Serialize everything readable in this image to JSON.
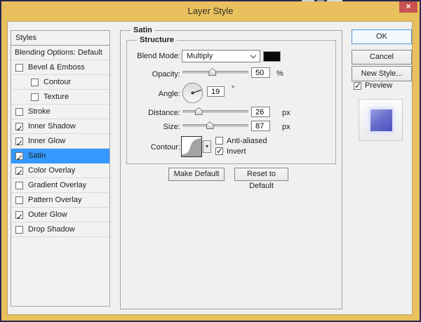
{
  "window": {
    "title": "Layer Style",
    "close_glyph": "×"
  },
  "sidebar": {
    "header": "Styles",
    "items": [
      {
        "label": "Blending Options: Default",
        "checkbox": false,
        "checked": false,
        "indent": false,
        "selected": false
      },
      {
        "label": "Bevel & Emboss",
        "checkbox": true,
        "checked": false,
        "indent": false,
        "selected": false
      },
      {
        "label": "Contour",
        "checkbox": true,
        "checked": false,
        "indent": true,
        "selected": false
      },
      {
        "label": "Texture",
        "checkbox": true,
        "checked": false,
        "indent": true,
        "selected": false
      },
      {
        "label": "Stroke",
        "checkbox": true,
        "checked": false,
        "indent": false,
        "selected": false
      },
      {
        "label": "Inner Shadow",
        "checkbox": true,
        "checked": true,
        "indent": false,
        "selected": false
      },
      {
        "label": "Inner Glow",
        "checkbox": true,
        "checked": true,
        "indent": false,
        "selected": false
      },
      {
        "label": "Satin",
        "checkbox": true,
        "checked": true,
        "indent": false,
        "selected": true
      },
      {
        "label": "Color Overlay",
        "checkbox": true,
        "checked": true,
        "indent": false,
        "selected": false
      },
      {
        "label": "Gradient Overlay",
        "checkbox": true,
        "checked": false,
        "indent": false,
        "selected": false
      },
      {
        "label": "Pattern Overlay",
        "checkbox": true,
        "checked": false,
        "indent": false,
        "selected": false
      },
      {
        "label": "Outer Glow",
        "checkbox": true,
        "checked": true,
        "indent": false,
        "selected": false
      },
      {
        "label": "Drop Shadow",
        "checkbox": true,
        "checked": false,
        "indent": false,
        "selected": false
      }
    ]
  },
  "panel": {
    "title": "Satin",
    "group_title": "Structure",
    "blend_mode": {
      "label": "Blend Mode:",
      "value": "Multiply",
      "swatch_color": "#0a0a0a"
    },
    "opacity": {
      "label": "Opacity:",
      "value": "50",
      "unit": "%",
      "slider_pct": 45
    },
    "angle": {
      "label": "Angle:",
      "value": "19",
      "unit": "°",
      "degrees": 19
    },
    "distance": {
      "label": "Distance:",
      "value": "26",
      "unit": "px",
      "slider_pct": 24
    },
    "size": {
      "label": "Size:",
      "value": "87",
      "unit": "px",
      "slider_pct": 41
    },
    "contour": {
      "label": "Contour:",
      "arrow_glyph": "▾"
    },
    "anti_aliased": {
      "label": "Anti-aliased",
      "checked": false
    },
    "invert": {
      "label": "Invert",
      "checked": true
    },
    "make_default_label": "Make Default",
    "reset_default_label": "Reset to Default"
  },
  "actions": {
    "ok_label": "OK",
    "cancel_label": "Cancel",
    "new_style_label": "New Style...",
    "preview": {
      "label": "Preview",
      "checked": true
    }
  },
  "colors": {
    "titlebar_gold": "#e9c05e",
    "selection_blue": "#3399ff",
    "close_red": "#c85250",
    "preview_blue": "#5a61c2"
  }
}
